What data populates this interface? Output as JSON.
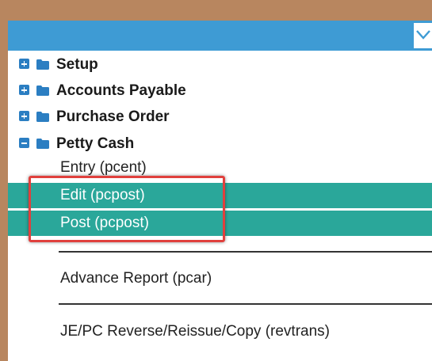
{
  "colors": {
    "frame": "#b8865f",
    "header": "#3e9bd4",
    "highlight": "#2aa79a",
    "expander": "#2b7ec2",
    "callout": "#e0403d"
  },
  "tree": {
    "folders": [
      {
        "label": "Setup",
        "expanded": false,
        "icon": "folder-icon"
      },
      {
        "label": "Accounts Payable",
        "expanded": false,
        "icon": "folder-icon"
      },
      {
        "label": "Purchase Order",
        "expanded": false,
        "icon": "folder-icon"
      },
      {
        "label": "Petty Cash",
        "expanded": true,
        "icon": "folder-icon"
      }
    ],
    "petty_cash_items": [
      {
        "label": "Entry (pcent)",
        "highlighted": false
      },
      {
        "label": "Edit (pcpost)",
        "highlighted": true
      },
      {
        "label": "Post (pcpost)",
        "highlighted": true
      },
      {
        "label": "Advance Report (pcar)",
        "highlighted": false
      },
      {
        "label": "JE/PC Reverse/Reissue/Copy (revtrans)",
        "highlighted": false
      }
    ]
  },
  "header": {
    "dropdown_icon": "chevron-down-icon"
  }
}
